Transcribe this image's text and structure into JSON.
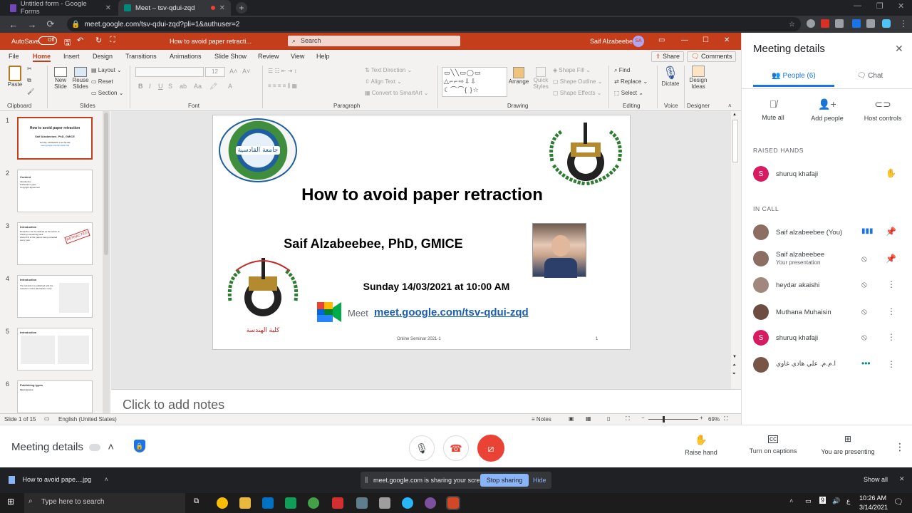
{
  "browser": {
    "tabs": [
      {
        "title": "Untitled form - Google Forms",
        "active": false
      },
      {
        "title": "Meet – tsv-qdui-zqd",
        "active": true
      }
    ],
    "url": "meet.google.com/tsv-qdui-zqd?pli=1&authuser=2"
  },
  "ppt": {
    "autosave_label": "AutoSave",
    "autosave_state": "Off",
    "doc_title": "How to avoid paper retracti...",
    "search_placeholder": "Search",
    "user_name": "Saif Alzabeebee",
    "user_initials": "SA",
    "share_label": "Share",
    "comments_label": "Comments",
    "menu": [
      "File",
      "Home",
      "Insert",
      "Design",
      "Transitions",
      "Animations",
      "Slide Show",
      "Review",
      "View",
      "Help"
    ],
    "active_menu": "Home",
    "ribbon": {
      "paste": "Paste",
      "clipboard": "Clipboard",
      "new_slide": "New Slide",
      "reuse_slides": "Reuse Slides",
      "layout": "Layout",
      "reset": "Reset",
      "section": "Section",
      "slides": "Slides",
      "font_size": "12",
      "font": "Font",
      "text_direction": "Text Direction",
      "align_text": "Align Text",
      "convert_smartart": "Convert to SmartArt",
      "paragraph": "Paragraph",
      "arrange": "Arrange",
      "quick_styles": "Quick Styles",
      "shape_fill": "Shape Fill",
      "shape_outline": "Shape Outline",
      "shape_effects": "Shape Effects",
      "drawing": "Drawing",
      "find": "Find",
      "replace": "Replace",
      "select": "Select",
      "editing": "Editing",
      "dictate": "Dictate",
      "voice": "Voice",
      "design_ideas": "Design Ideas",
      "designer": "Designer"
    },
    "thumbnails": [
      {
        "num": "1",
        "title": "How to avoid paper retraction",
        "sub": "Saif Alzabeebee, PhD, GMICE",
        "extra": "Sunday 14/03/2021 at 10:00 AM",
        "link": "meet.google.com/tsv-qdui-zqd"
      },
      {
        "num": "2",
        "title": "Content",
        "sub": "Introduction",
        "extra": "Publication types",
        "link": "Copyright agreement"
      },
      {
        "num": "3",
        "title": "Introduction",
        "sub": "Retraction can be defined as the action of drawing something back",
        "extra": "About 1% of the papers being retracted every year",
        "link": "RETRACTED"
      },
      {
        "num": "4",
        "title": "Introduction",
        "sub": "The retraction is published with the retraction notice (Retraction note)",
        "extra": "",
        "link": ""
      },
      {
        "num": "5",
        "title": "Introduction",
        "sub": "",
        "extra": "",
        "link": ""
      },
      {
        "num": "6",
        "title": "Publishing types",
        "sub": "Open access",
        "extra": "",
        "link": ""
      }
    ],
    "slide": {
      "title": "How to avoid paper retraction",
      "author": "Saif Alzabeebee, PhD, GMICE",
      "date": "Sunday 14/03/2021 at 10:00 AM",
      "meet_word": "Meet",
      "meet_link": "meet.google.com/tsv-qdui-zqd",
      "footer": "Online Seminar 2021-1",
      "page": "1",
      "logo_text_left": "جامعة القادسية",
      "logo_text_bottom": "كلية الهندسة"
    },
    "notes_placeholder": "Click to add notes",
    "status": {
      "slide_of": "Slide 1 of 15",
      "language": "English (United States)",
      "notes": "Notes",
      "zoom": "69%"
    }
  },
  "meet": {
    "panel_title": "Meeting details",
    "tab_people": "People (6)",
    "tab_chat": "Chat",
    "actions": [
      "Mute all",
      "Add people",
      "Host controls"
    ],
    "raised_hands_label": "RAISED HANDS",
    "raised": [
      {
        "name": "shuruq khafaji",
        "initial": "S",
        "color": "#d81b60"
      }
    ],
    "in_call_label": "IN CALL",
    "participants": [
      {
        "name": "Saif alzabeebee (You)",
        "sub": "",
        "initial": "",
        "color": "#8d6e63"
      },
      {
        "name": "Saif alzabeebee",
        "sub": "Your presentation",
        "initial": "",
        "color": "#8d6e63"
      },
      {
        "name": "heydar akaishi",
        "sub": "",
        "initial": "",
        "color": "#a1887f"
      },
      {
        "name": "Muthana Muhaisin",
        "sub": "",
        "initial": "",
        "color": "#6d4c41"
      },
      {
        "name": "shuruq khafaji",
        "sub": "",
        "initial": "S",
        "color": "#d81b60"
      },
      {
        "name": "ا.م.م. علي هادي غاوي",
        "sub": "",
        "initial": "",
        "color": "#795548"
      }
    ],
    "bar": {
      "details_label": "Meeting details",
      "raise_hand": "Raise hand",
      "captions": "Turn on captions",
      "presenting": "You are presenting"
    }
  },
  "downloads": {
    "file": "How to avoid pape....jpg",
    "sharing_text": "meet.google.com is sharing your screen.",
    "stop_sharing": "Stop sharing",
    "hide": "Hide",
    "show_all": "Show all"
  },
  "taskbar": {
    "search_placeholder": "Type here to search",
    "time": "10:26 AM",
    "date": "3/14/2021",
    "lang": "ع",
    "notif_count": "9"
  }
}
